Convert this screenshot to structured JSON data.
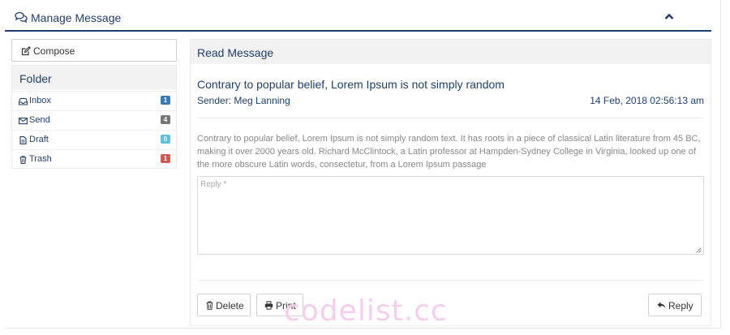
{
  "header": {
    "title": "Manage Message",
    "collapse_icon": "chevron-up-icon",
    "title_icon": "comments-icon",
    "accent_color": "#1e3f6e"
  },
  "sidebar": {
    "compose_label": "Compose",
    "compose_icon": "edit-icon",
    "folder_title": "Folder",
    "items": [
      {
        "label": "Inbox",
        "icon": "inbox-icon",
        "count": "1",
        "badge_color": "#337ab7"
      },
      {
        "label": "Send",
        "icon": "envelope-icon",
        "count": "4",
        "badge_color": "#777777"
      },
      {
        "label": "Draft",
        "icon": "file-icon",
        "count": "0",
        "badge_color": "#5bc0de"
      },
      {
        "label": "Trash",
        "icon": "trash-icon",
        "count": "1",
        "badge_color": "#d9534f"
      }
    ]
  },
  "message": {
    "panel_title": "Read Message",
    "subject": "Contrary to popular belief, Lorem Ipsum is not simply random",
    "sender": "Sender: Meg Lanning",
    "date": "14 Feb, 2018 02:56:13 am",
    "body": "Contrary to popular belief, Lorem Ipsum is not simply random text. It has roots in a piece of classical Latin literature from 45 BC, making it over 2000 years old. Richard McClintock, a Latin professor at Hampden-Sydney College in Virginia, looked up one of the more obscure Latin words, consectetur, from a Lorem Ipsum passage",
    "reply_placeholder": "Reply *",
    "reply_value": ""
  },
  "actions": {
    "delete_label": "Delete",
    "print_label": "Print",
    "reply_label": "Reply"
  },
  "watermark": "codelist.cc"
}
